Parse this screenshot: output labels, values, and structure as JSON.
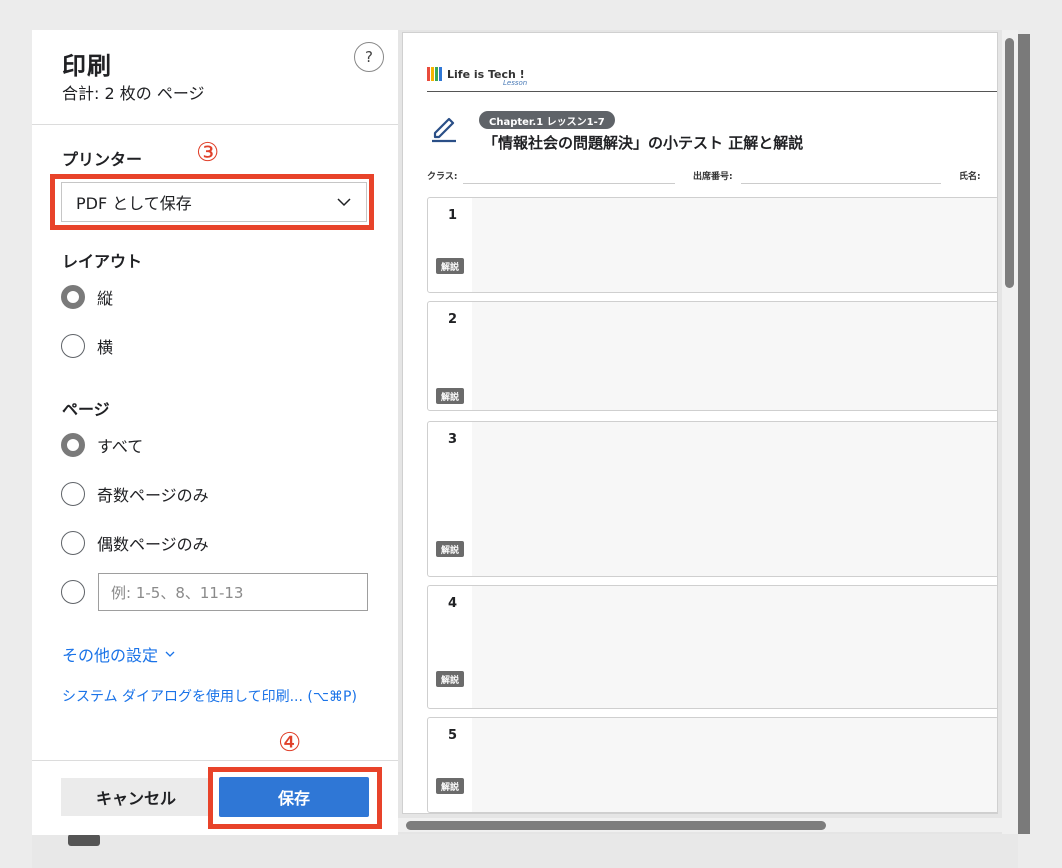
{
  "dialog": {
    "title": "印刷",
    "subtitle": "合計: 2 枚の ページ",
    "help_label": "?"
  },
  "printer": {
    "label": "プリンター",
    "selected": "PDF として保存"
  },
  "annotations": {
    "step3": "③",
    "step4": "④"
  },
  "layout": {
    "label": "レイアウト",
    "options": [
      "縦",
      "横"
    ],
    "selected_index": 0
  },
  "pages": {
    "label": "ページ",
    "options": [
      "すべて",
      "奇数ページのみ",
      "偶数ページのみ"
    ],
    "selected_index": 0,
    "custom_placeholder": "例: 1-5、8、11-13"
  },
  "links": {
    "more_settings": "その他の設定",
    "system_dialog": "システム ダイアログを使用して印刷... (⌥⌘P)"
  },
  "buttons": {
    "cancel": "キャンセル",
    "save": "保存"
  },
  "preview": {
    "logo_text": "Life is Tech !",
    "logo_sub": "Lesson",
    "chapter_badge": "Chapter.1 レッスン1-7",
    "doc_title": "「情報社会の問題解決」の小テスト 正解と解説",
    "fields": [
      "クラス:",
      "出席番号:",
      "氏名:"
    ],
    "question_numbers": [
      "1",
      "2",
      "3",
      "4",
      "5"
    ],
    "explanation_label": "解説"
  },
  "colors": {
    "annotation_red": "#e8432a",
    "save_blue": "#2f77d6",
    "link_blue": "#1a73e8"
  }
}
